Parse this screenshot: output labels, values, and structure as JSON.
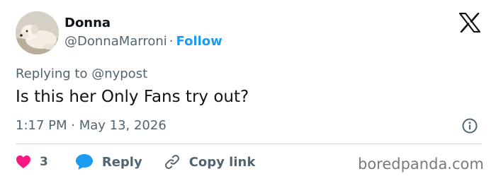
{
  "author": {
    "name": "Donna",
    "handle": "@DonnaMarroni",
    "separator": "·",
    "follow_label": "Follow",
    "avatar_icon": "dog-photo-avatar"
  },
  "brand_icon": "x-logo-icon",
  "reply_context": "Replying to @nypost",
  "tweet_text": "Is this her Only Fans try out?",
  "timestamp": "1:17 PM · May 13, 2026",
  "info_icon": "info-icon",
  "actions": {
    "like_icon": "heart-icon",
    "like_count": "3",
    "reply_icon": "speech-bubble-icon",
    "reply_label": "Reply",
    "copy_icon": "link-icon",
    "copy_label": "Copy link"
  },
  "watermark": "boredpanda.com",
  "colors": {
    "accent": "#1d9bf0",
    "like": "#f91880",
    "text": "#0f1419",
    "secondary": "#536471"
  }
}
